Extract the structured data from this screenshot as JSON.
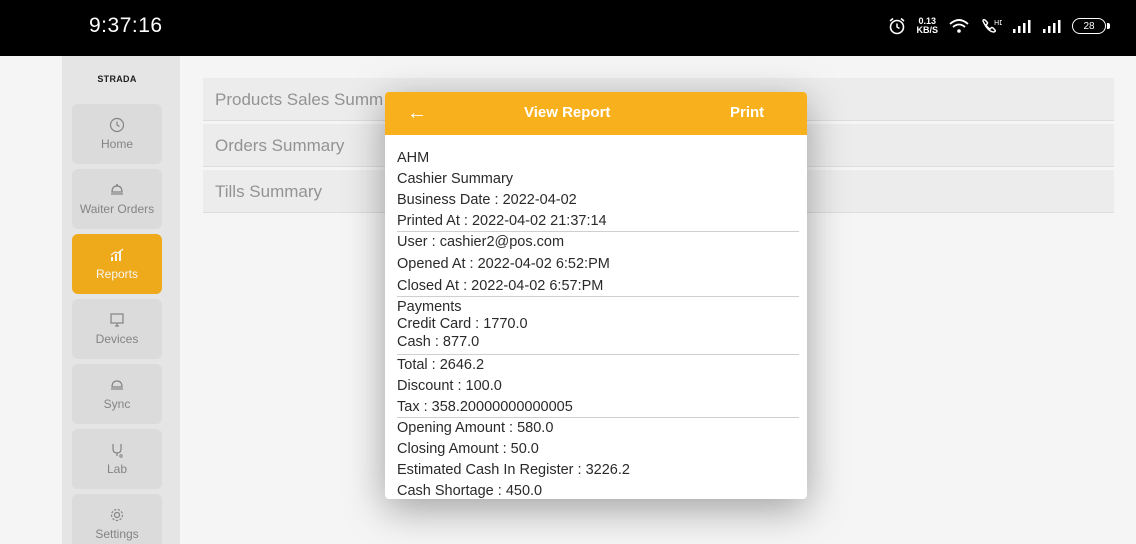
{
  "status_bar": {
    "time": "9:37:16",
    "net_speed_value": "0.13",
    "net_speed_unit": "KB/S",
    "battery": "28",
    "icons": [
      "alarm-icon",
      "wifi-icon",
      "volte-icon",
      "signal-icon",
      "signal-icon",
      "battery-icon"
    ]
  },
  "sidebar": {
    "brand": "STRADA",
    "items": [
      {
        "label": "Home",
        "icon": "clock-icon"
      },
      {
        "label": "Waiter Orders",
        "icon": "waiter-icon"
      },
      {
        "label": "Reports",
        "icon": "chart-icon",
        "active": true
      },
      {
        "label": "Devices",
        "icon": "devices-icon"
      },
      {
        "label": "Sync",
        "icon": "sync-icon"
      },
      {
        "label": "Lab",
        "icon": "lab-icon"
      },
      {
        "label": "Settings",
        "icon": "gear-icon"
      }
    ]
  },
  "list": {
    "items": [
      "Products Sales Summ",
      "Orders Summary",
      "Tills Summary"
    ]
  },
  "dialog": {
    "back_icon": "←",
    "title": "View Report",
    "print_label": "Print",
    "header_color": "#f8b11c",
    "report": {
      "store": "AHM",
      "type": "Cashier Summary",
      "business_date": "Business Date : 2022-04-02",
      "printed_at": "Printed At : 2022-04-02 21:37:14",
      "user": "User : cashier2@pos.com",
      "opened_at": "Opened At : 2022-04-02 6:52:PM",
      "closed_at": "Closed At : 2022-04-02 6:57:PM",
      "payments_heading": "Payments",
      "credit_card": "Credit Card : 1770.0",
      "cash": "Cash : 877.0",
      "total": "Total : 2646.2",
      "discount": "Discount : 100.0",
      "tax": "Tax : 358.20000000000005",
      "opening_amount": "Opening Amount : 580.0",
      "closing_amount": "Closing Amount : 50.0",
      "estimated_cash": "Estimated Cash In Register : 3226.2",
      "cash_shortage": "Cash Shortage : 450.0"
    }
  }
}
